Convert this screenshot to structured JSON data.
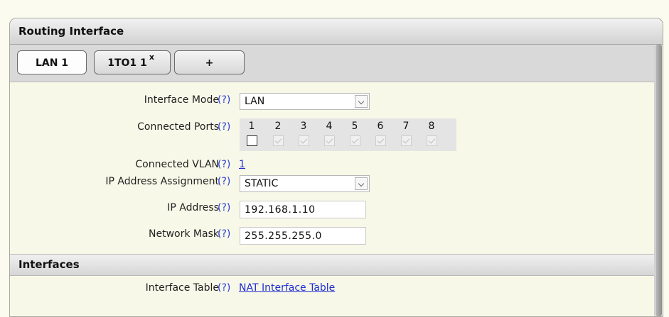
{
  "panel": {
    "title": "Routing Interface"
  },
  "tabs": [
    {
      "label": "LAN 1",
      "active": true
    },
    {
      "label": "1TO1 1",
      "close": "x"
    },
    {
      "label": "+"
    }
  ],
  "form": {
    "help": "(?)",
    "interface_mode": {
      "label": "Interface Mode",
      "value": "LAN"
    },
    "connected_ports": {
      "label": "Connected Ports",
      "ports": [
        "1",
        "2",
        "3",
        "4",
        "5",
        "6",
        "7",
        "8"
      ],
      "checked": [
        false,
        true,
        true,
        true,
        true,
        true,
        true,
        true
      ],
      "disabled": [
        false,
        true,
        true,
        true,
        true,
        true,
        true,
        true
      ]
    },
    "connected_vlan": {
      "label": "Connected VLAN",
      "value": "1"
    },
    "ip_assignment": {
      "label": "IP Address Assignment",
      "value": "STATIC"
    },
    "ip_address": {
      "label": "IP Address",
      "value": "192.168.1.10"
    },
    "network_mask": {
      "label": "Network Mask",
      "value": "255.255.255.0"
    }
  },
  "interfaces": {
    "title": "Interfaces",
    "interface_table": {
      "label": "Interface Table",
      "link": "NAT Interface Table"
    }
  }
}
